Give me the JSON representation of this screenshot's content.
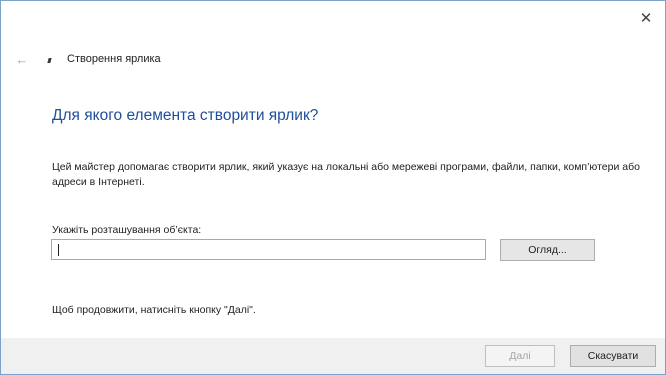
{
  "window": {
    "close_glyph": "✕"
  },
  "nav": {
    "back_glyph": "←",
    "title": "Створення ярлика"
  },
  "main": {
    "heading": "Для якого елемента створити ярлик?",
    "description": "Цей майстер допомагає створити ярлик, який указує на локальні або мережеві програми, файли, папки, комп’ютери або адреси в Інтернеті.",
    "location_label": "Укажіть розташування об’єкта:",
    "location_value": "",
    "browse_label": "Огляд...",
    "hint": "Щоб продовжити, натисніть кнопку \"Далі\"."
  },
  "footer": {
    "next_label": "Далі",
    "cancel_label": "Скасувати"
  },
  "colors": {
    "heading": "#1f4e9a",
    "window_border": "#7aa3c9",
    "input_border": "#7eb4ea",
    "footer_bg": "#f0f0f0"
  }
}
